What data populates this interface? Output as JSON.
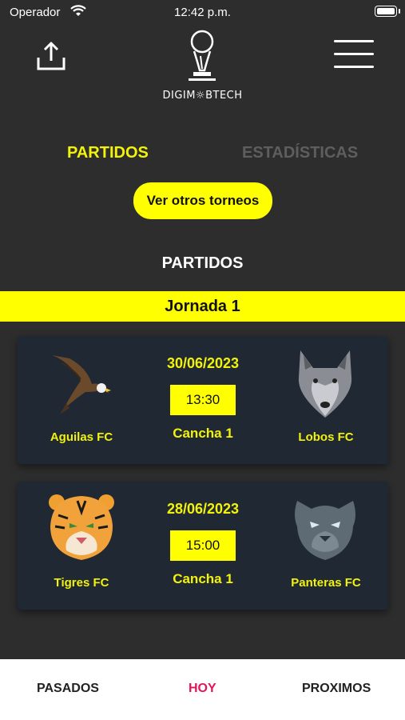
{
  "status_bar": {
    "carrier": "Operador",
    "time": "12:42 p.m."
  },
  "header": {
    "logo_text": "DIGIM☼BTECH",
    "share_icon": "share-icon",
    "menu_icon": "hamburger-menu-icon"
  },
  "tabs": [
    {
      "label": "PARTIDOS",
      "active": true
    },
    {
      "label": "ESTADÍSTICAS",
      "active": false
    }
  ],
  "other_tournaments_button": "Ver otros torneos",
  "section_title": "PARTIDOS",
  "round_title": "Jornada 1",
  "matches": [
    {
      "home_team": "Aguilas FC",
      "home_icon": "eagle-icon",
      "away_team": "Lobos FC",
      "away_icon": "wolf-icon",
      "date": "30/06/2023",
      "time": "13:30",
      "venue": "Cancha 1"
    },
    {
      "home_team": "Tigres FC",
      "home_icon": "tiger-icon",
      "away_team": "Panteras FC",
      "away_icon": "panther-icon",
      "date": "28/06/2023",
      "time": "15:00",
      "venue": "Cancha 1"
    }
  ],
  "bottom_nav": [
    {
      "label": "PASADOS",
      "active": false
    },
    {
      "label": "HOY",
      "active": true
    },
    {
      "label": "PROXIMOS",
      "active": false
    }
  ],
  "colors": {
    "accent": "#ffff00",
    "background": "#2d2d2d",
    "card": "#1f2833",
    "active_nav": "#e0165a"
  }
}
